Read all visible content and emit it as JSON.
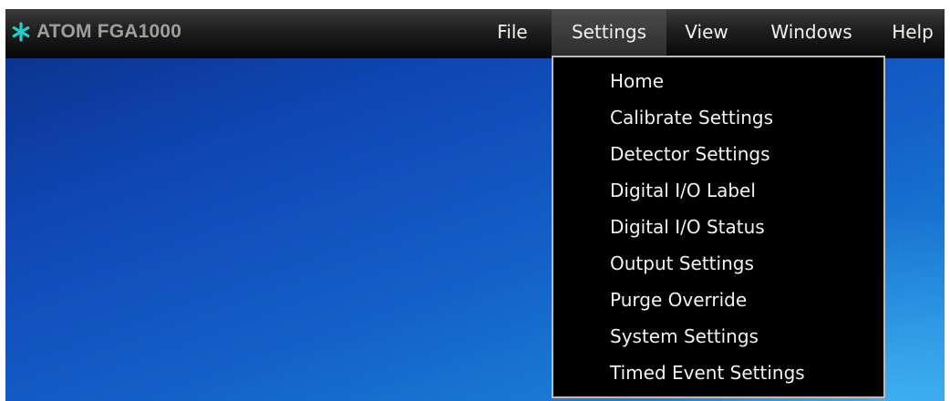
{
  "app": {
    "title": "ATOM FGA1000",
    "logo_icon": "snowflake-logo-icon",
    "logo_color": "#1fd0c8"
  },
  "menubar": {
    "items": [
      {
        "label": "File",
        "active": false
      },
      {
        "label": "Settings",
        "active": true
      },
      {
        "label": "View",
        "active": false
      },
      {
        "label": "Windows",
        "active": false
      },
      {
        "label": "Help",
        "active": false
      }
    ]
  },
  "settings_menu": {
    "items": [
      {
        "label": "Home"
      },
      {
        "label": "Calibrate Settings"
      },
      {
        "label": "Detector Settings"
      },
      {
        "label": "Digital I/O Label"
      },
      {
        "label": "Digital I/O Status"
      },
      {
        "label": "Output Settings"
      },
      {
        "label": "Purge Override"
      },
      {
        "label": "System Settings"
      },
      {
        "label": "Timed Event Settings"
      }
    ]
  },
  "colors": {
    "menubar_bg": "#111111",
    "dropdown_bg": "#000000",
    "desktop_blue": "#1460c8"
  }
}
